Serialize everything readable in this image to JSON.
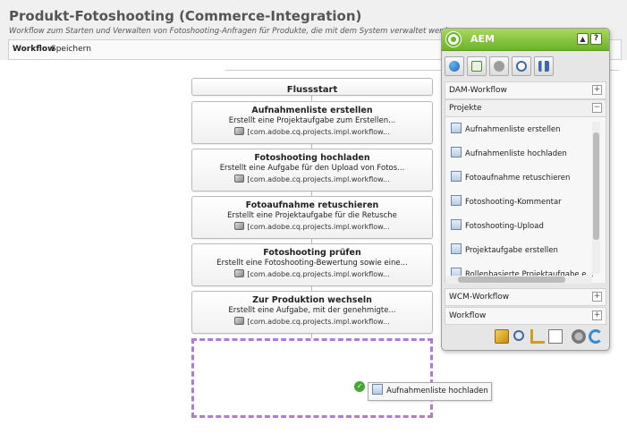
{
  "page": {
    "title": "Produkt-Fotoshooting (Commerce-Integration)",
    "subtitle": "Workflow zum Starten und Verwalten von Fotoshooting-Anfragen für Produkte, die mit dem System verwaltet werden"
  },
  "toolbar": {
    "workflow_label": "Workflow",
    "save_label": "Speichern"
  },
  "flow": {
    "start_label": "Flussstart",
    "steps": [
      {
        "title": "Aufnahmenliste erstellen",
        "desc": "Erstellt eine Projektaufgabe zum Erstellen...",
        "impl": "[com.adobe.cq.projects.impl.workflow..."
      },
      {
        "title": "Fotoshooting hochladen",
        "desc": "Erstellt eine Aufgabe für den Upload von Fotos...",
        "impl": "[com.adobe.cq.projects.impl.workflow..."
      },
      {
        "title": "Fotoaufnahme retuschieren",
        "desc": "Erstellt eine Projektaufgabe für die Retusche",
        "impl": "[com.adobe.cq.projects.impl.workflow..."
      },
      {
        "title": "Fotoshooting prüfen",
        "desc": "Erstellt eine Fotoshooting-Bewertung sowie eine...",
        "impl": "[com.adobe.cq.projects.impl.workflow..."
      },
      {
        "title": "Zur Produktion wechseln",
        "desc": "Erstellt eine Aufgabe, mit der genehmigte...",
        "impl": "[com.adobe.cq.projects.impl.workflow..."
      }
    ]
  },
  "drag": {
    "label": "Aufnahmenliste hochladen",
    "check_glyph": "✓"
  },
  "sidekick": {
    "title": "AEM",
    "collapse_glyph": "▲",
    "help_glyph": "?",
    "sections": {
      "dam": "DAM-Workflow",
      "projekte": "Projekte",
      "wcm": "WCM-Workflow",
      "workflow": "Workflow"
    },
    "expand_plus": "+",
    "expand_minus": "−",
    "items": [
      "Aufnahmenliste erstellen",
      "Aufnahmenliste hochladen",
      "Fotoaufnahme retuschieren",
      "Fotoshooting-Kommentar",
      "Fotoshooting-Upload",
      "Projektaufgabe erstellen",
      "Rollenbasierte Projektaufgabe e..."
    ]
  },
  "colors": {
    "accent_green": "#6ab42a",
    "drop_zone": "#b07ccf"
  }
}
